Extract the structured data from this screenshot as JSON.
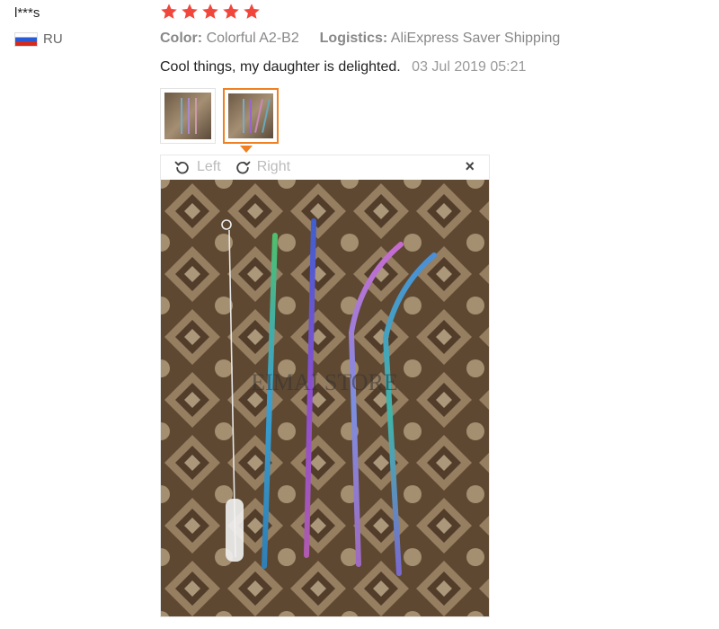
{
  "user": {
    "name": "l***s",
    "country": "RU"
  },
  "rating": {
    "stars": 5,
    "max": 5
  },
  "attributes": {
    "color_key": "Color:",
    "color_value": "Colorful A2-B2",
    "logistics_key": "Logistics:",
    "logistics_value": "AliExpress Saver Shipping"
  },
  "review": {
    "text": "Cool things, my daughter is delighted.",
    "date": "03 Jul 2019 05:21"
  },
  "viewer": {
    "left_label": "Left",
    "right_label": "Right",
    "close_label": "×",
    "watermark": "EIMAI STORE"
  },
  "colors": {
    "accent": "#f08021",
    "star": "#f0463c"
  }
}
